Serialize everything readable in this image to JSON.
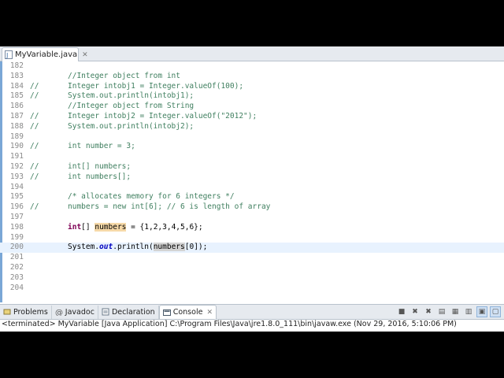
{
  "editor_tab": {
    "title": "MyVariable.java",
    "close": "✕"
  },
  "lines": [
    {
      "num": "182",
      "comment_marker": "",
      "current": false,
      "tokens": []
    },
    {
      "num": "183",
      "comment_marker": "",
      "current": false,
      "tokens": [
        {
          "t": "//Integer object from int",
          "c": "c"
        }
      ]
    },
    {
      "num": "184",
      "comment_marker": "//",
      "current": false,
      "tokens": [
        {
          "t": "Integer intobj1 = Integer.valueOf(100);",
          "c": "c"
        }
      ]
    },
    {
      "num": "185",
      "comment_marker": "//",
      "current": false,
      "tokens": [
        {
          "t": "System.out.println(intobj1);",
          "c": "c"
        }
      ]
    },
    {
      "num": "186",
      "comment_marker": "",
      "current": false,
      "tokens": [
        {
          "t": "//Integer object from String",
          "c": "c"
        }
      ]
    },
    {
      "num": "187",
      "comment_marker": "//",
      "current": false,
      "tokens": [
        {
          "t": "Integer intobj2 = Integer.valueOf(\"2012\");",
          "c": "c"
        }
      ]
    },
    {
      "num": "188",
      "comment_marker": "//",
      "current": false,
      "tokens": [
        {
          "t": "System.out.println(intobj2);",
          "c": "c"
        }
      ]
    },
    {
      "num": "189",
      "comment_marker": "",
      "current": false,
      "tokens": []
    },
    {
      "num": "190",
      "comment_marker": "//",
      "current": false,
      "tokens": [
        {
          "t": "int number = 3;",
          "c": "c"
        }
      ]
    },
    {
      "num": "191",
      "comment_marker": "",
      "current": false,
      "tokens": []
    },
    {
      "num": "192",
      "comment_marker": "//",
      "current": false,
      "tokens": [
        {
          "t": "int[] numbers;",
          "c": "c"
        }
      ]
    },
    {
      "num": "193",
      "comment_marker": "//",
      "current": false,
      "tokens": [
        {
          "t": "int numbers[];",
          "c": "c"
        }
      ]
    },
    {
      "num": "194",
      "comment_marker": "",
      "current": false,
      "tokens": []
    },
    {
      "num": "195",
      "comment_marker": "",
      "current": false,
      "tokens": [
        {
          "t": "/* allocates memory for 6 integers */",
          "c": "c"
        }
      ]
    },
    {
      "num": "196",
      "comment_marker": "//",
      "current": false,
      "tokens": [
        {
          "t": "numbers = new int[6]; // 6 is length of array",
          "c": "c"
        }
      ]
    },
    {
      "num": "197",
      "comment_marker": "",
      "current": false,
      "tokens": []
    },
    {
      "num": "198",
      "comment_marker": "",
      "current": false,
      "tokens": [
        {
          "t": "int",
          "c": "k"
        },
        {
          "t": "[] ",
          "c": "p"
        },
        {
          "t": "numbers",
          "c": "p",
          "h": "hl"
        },
        {
          "t": " = {1,2,3,4,5,6};",
          "c": "p"
        }
      ]
    },
    {
      "num": "199",
      "comment_marker": "",
      "current": false,
      "tokens": []
    },
    {
      "num": "200",
      "comment_marker": "",
      "current": true,
      "tokens": [
        {
          "t": "System.",
          "c": "p"
        },
        {
          "t": "out",
          "c": "i"
        },
        {
          "t": ".println(",
          "c": "p"
        },
        {
          "t": "numbers",
          "c": "p",
          "h": "hl2"
        },
        {
          "t": "[0]);",
          "c": "p"
        }
      ]
    },
    {
      "num": "201",
      "comment_marker": "",
      "current": false,
      "tokens": []
    },
    {
      "num": "202",
      "comment_marker": "",
      "current": false,
      "tokens": []
    },
    {
      "num": "203",
      "comment_marker": "",
      "current": false,
      "tokens": []
    },
    {
      "num": "204",
      "comment_marker": "",
      "current": false,
      "tokens": []
    }
  ],
  "hscroll_glyph": "<",
  "bottom_tabs": [
    {
      "label": "Problems",
      "icon": "problems-icon",
      "active": false
    },
    {
      "label": "Javadoc",
      "icon": "javadoc-icon",
      "active": false
    },
    {
      "label": "Declaration",
      "icon": "declaration-icon",
      "active": false
    },
    {
      "label": "Console",
      "icon": "console-icon",
      "active": true
    }
  ],
  "console_close": "✕",
  "status_text": "<terminated> MyVariable [Java Application] C:\\Program Files\\Java\\jre1.8.0_111\\bin\\javaw.exe (Nov 29, 2016, 5:10:06 PM)",
  "colors": {
    "comment": "#3f7f5f",
    "keyword": "#7f0055",
    "field": "#0000c0",
    "current_line": "#e8f2fe",
    "highlight": "#f6d9a8"
  }
}
